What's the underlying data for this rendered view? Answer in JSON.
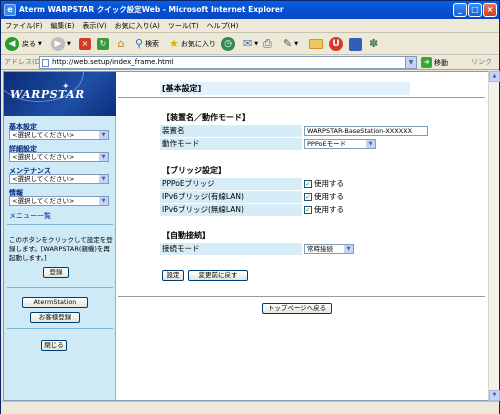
{
  "window": {
    "title": "Aterm WARPSTAR クイック設定Web - Microsoft Internet Explorer"
  },
  "menu": [
    "ファイル(F)",
    "編集(E)",
    "表示(V)",
    "お気に入り(A)",
    "ツール(T)",
    "ヘルプ(H)"
  ],
  "toolbar": {
    "back": "戻る",
    "search": "検索",
    "favorites": "お気に入り"
  },
  "address": {
    "label": "アドレス(D)",
    "url": "http://web.setup/index_frame.html",
    "go": "移動",
    "links": "リンク"
  },
  "sidebar": {
    "logo": "WARPSTAR",
    "groups": [
      {
        "label": "基本設定",
        "select": "<選択してください>"
      },
      {
        "label": "詳細設定",
        "select": "<選択してください>"
      },
      {
        "label": "メンテナンス",
        "select": "<選択してください>"
      },
      {
        "label": "情報",
        "select": "<選択してください>"
      }
    ],
    "menu_list": "メニュー一覧",
    "note": "このボタンをクリックして設定を登録します。[WARPSTAR(親機)を再起動します。]",
    "register": "登録",
    "aterm_station": "AtermStation",
    "customer_reg": "お客様登録",
    "close": "閉じる"
  },
  "main": {
    "title": "[基本設定]",
    "section1": {
      "header": "【装置名／動作モード】",
      "device_name_label": "装置名",
      "device_name_value": "WARPSTAR-BaseStation-XXXXXX",
      "mode_label": "動作モード",
      "mode_value": "PPPoEモード"
    },
    "section2": {
      "header": "【ブリッジ設定】",
      "rows": [
        {
          "label": "PPPoEブリッジ",
          "check": "使用する"
        },
        {
          "label": "IPv6ブリッジ(有線LAN)",
          "check": "使用する"
        },
        {
          "label": "IPv6ブリッジ(無線LAN)",
          "check": "使用する"
        }
      ]
    },
    "section3": {
      "header": "【自動接続】",
      "conn_label": "接続モード",
      "conn_value": "常時接続"
    },
    "set_button": "設定",
    "revert_button": "変更前に戻す",
    "top_button": "トップページへ戻る"
  }
}
